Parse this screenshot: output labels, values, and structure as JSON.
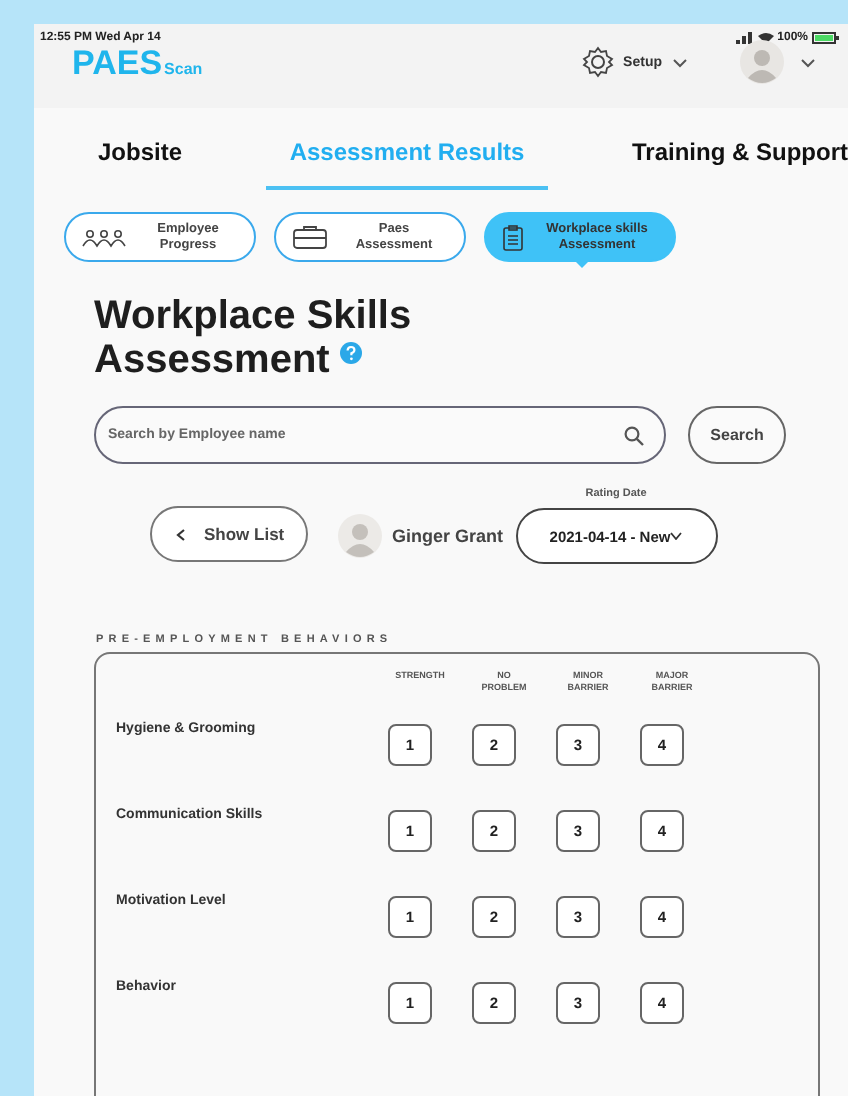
{
  "status_bar": {
    "time": "12:55 PM  Wed Apr 14",
    "battery": "100%"
  },
  "header": {
    "logo": {
      "main": "PAES",
      "sub": "Scan"
    },
    "setup": "Setup"
  },
  "tabs": [
    {
      "label": "Jobsite",
      "selected": false
    },
    {
      "label": "Assessment Results",
      "selected": true
    },
    {
      "label": "Training & Support",
      "selected": false
    }
  ],
  "subtabs": [
    {
      "kind": "people",
      "label": "Employee Progress",
      "selected": false
    },
    {
      "kind": "briefcase",
      "label": "Paes Assessment",
      "selected": false
    },
    {
      "kind": "clipboard",
      "label": "Workplace skills Assessment",
      "selected": true
    }
  ],
  "title": "Workplace Skills Assessment",
  "search": {
    "placeholder": "Search by Employee name",
    "button": "Search"
  },
  "employee": {
    "show_list": "Show List",
    "name": "Ginger Grant",
    "rating_date_label": "Rating Date",
    "rating_date": "2021-04-14 - New"
  },
  "section": {
    "title": "PRE-EMPLOYMENT BEHAVIORS",
    "columns": [
      "STRENGTH",
      "NO PROBLEM",
      "MINOR BARRIER",
      "MAJOR BARRIER"
    ],
    "rows": [
      {
        "label": "Hygiene & Grooming",
        "ratings": [
          "1",
          "2",
          "3",
          "4"
        ]
      },
      {
        "label": "Communication Skills",
        "ratings": [
          "1",
          "2",
          "3",
          "4"
        ]
      },
      {
        "label": "Motivation Level",
        "ratings": [
          "1",
          "2",
          "3",
          "4"
        ]
      },
      {
        "label": "Behavior",
        "ratings": [
          "1",
          "2",
          "3",
          "4"
        ]
      }
    ]
  }
}
